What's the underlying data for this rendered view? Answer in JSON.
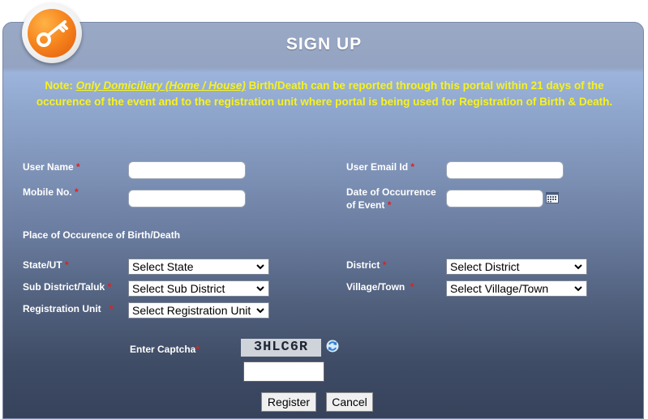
{
  "header": {
    "title": "SIGN UP"
  },
  "note": {
    "prefix": "Note: ",
    "emphasis": "Only Domiciliary (Home / House)",
    "rest": " Birth/Death can be reported through this portal within 21 days of the occurence of the event and to the registration unit where portal is being used for Registration of Birth & Death."
  },
  "form": {
    "user_name_label": "User Name",
    "user_email_label": "User Email Id",
    "mobile_label": "Mobile No.",
    "date_label_line1": "Date of Occurrence",
    "date_label_line2": "of Event",
    "place_heading": "Place of Occurence of Birth/Death",
    "state_label": "State/UT",
    "district_label": "District",
    "subdistrict_label": "Sub District/Taluk",
    "village_label": "Village/Town",
    "regunit_label": "Registration Unit",
    "required_mark": "*",
    "values": {
      "user_name": "",
      "user_email": "",
      "mobile": "",
      "date": "",
      "captcha_input": ""
    },
    "selects": {
      "state": "Select State",
      "district": "Select District",
      "subdistrict": "Select Sub District",
      "village": "Select Village/Town",
      "regunit": "Select Registration Unit"
    }
  },
  "captcha": {
    "label": "Enter Captcha",
    "code": "3HLC6R"
  },
  "buttons": {
    "register": "Register",
    "cancel": "Cancel"
  },
  "colors": {
    "note_text": "#f7f21e",
    "required": "#e02020",
    "key_badge": "#f7871f"
  },
  "icons": {
    "badge": "key-icon",
    "calendar": "calendar-icon",
    "refresh": "refresh-icon",
    "dropdown": "chevron-down-icon"
  }
}
